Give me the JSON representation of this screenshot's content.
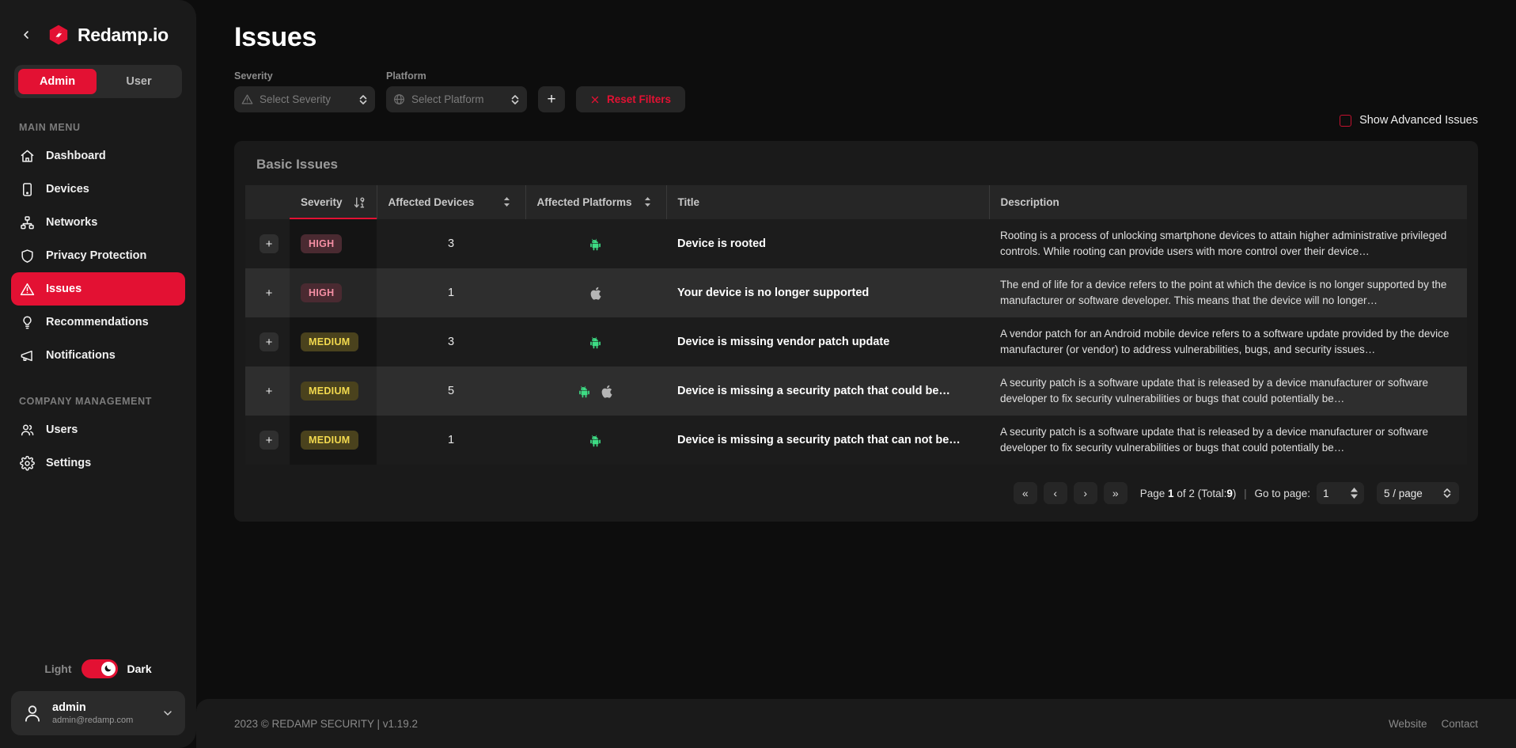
{
  "sidebar": {
    "back_icon": "chevron-left-icon",
    "brand": "Redamp.io",
    "roles": [
      {
        "label": "Admin",
        "active": true
      },
      {
        "label": "User",
        "active": false
      }
    ],
    "main_menu_label": "MAIN MENU",
    "main_menu": [
      {
        "label": "Dashboard",
        "icon": "home-icon",
        "active": false
      },
      {
        "label": "Devices",
        "icon": "device-icon",
        "active": false
      },
      {
        "label": "Networks",
        "icon": "network-icon",
        "active": false
      },
      {
        "label": "Privacy Protection",
        "icon": "shield-icon",
        "active": false
      },
      {
        "label": "Issues",
        "icon": "warning-triangle-icon",
        "active": true
      },
      {
        "label": "Recommendations",
        "icon": "lightbulb-icon",
        "active": false
      },
      {
        "label": "Notifications",
        "icon": "megaphone-icon",
        "active": false
      }
    ],
    "company_label": "COMPANY MANAGEMENT",
    "company_menu": [
      {
        "label": "Users",
        "icon": "users-icon",
        "active": false
      },
      {
        "label": "Settings",
        "icon": "gear-icon",
        "active": false
      }
    ],
    "theme": {
      "light_label": "Light",
      "dark_label": "Dark",
      "active": "Dark"
    },
    "user": {
      "name": "admin",
      "email": "admin@redamp.com"
    }
  },
  "header": {
    "title": "Issues"
  },
  "filters": {
    "severity": {
      "label": "Severity",
      "placeholder": "Select Severity",
      "icon": "warning-triangle-icon"
    },
    "platform": {
      "label": "Platform",
      "placeholder": "Select Platform",
      "icon": "globe-icon"
    },
    "add_label": "+",
    "reset_label": "Reset Filters",
    "advanced_label": "Show Advanced Issues",
    "advanced_checked": false
  },
  "card": {
    "title": "Basic Issues"
  },
  "table": {
    "columns": [
      {
        "key": "expand",
        "label": ""
      },
      {
        "key": "severity",
        "label": "Severity",
        "sortable": true,
        "sorted": true,
        "sort_icon": "sort-descending-icon"
      },
      {
        "key": "devices",
        "label": "Affected Devices",
        "sortable": true,
        "sort_icon": "sort-icon"
      },
      {
        "key": "platforms",
        "label": "Affected Platforms",
        "sortable": true,
        "sort_icon": "sort-icon"
      },
      {
        "key": "title",
        "label": "Title",
        "sortable": false
      },
      {
        "key": "description",
        "label": "Description",
        "sortable": false
      }
    ],
    "rows": [
      {
        "severity": "HIGH",
        "severity_class": "high",
        "devices": "3",
        "platforms": [
          "android"
        ],
        "title": "Device is rooted",
        "description": "Rooting is a process of unlocking smartphone devices to attain higher administrative privileged controls. While rooting can provide users with more control over their device…"
      },
      {
        "severity": "HIGH",
        "severity_class": "high",
        "devices": "1",
        "platforms": [
          "apple"
        ],
        "title": "Your device is no longer supported",
        "description": "The end of life for a device refers to the point at which the device is no longer supported by the manufacturer or software developer. This means that the device will no longer…"
      },
      {
        "severity": "MEDIUM",
        "severity_class": "medium",
        "devices": "3",
        "platforms": [
          "android"
        ],
        "title": "Device is missing vendor patch update",
        "description": "A vendor patch for an Android mobile device refers to a software update provided by the device manufacturer (or vendor) to address vulnerabilities, bugs, and security issues…"
      },
      {
        "severity": "MEDIUM",
        "severity_class": "medium",
        "devices": "5",
        "platforms": [
          "android",
          "apple"
        ],
        "title": "Device is missing a security patch that could be…",
        "description": "A security patch is a software update that is released by a device manufacturer or software developer to fix security vulnerabilities or bugs that could potentially be…"
      },
      {
        "severity": "MEDIUM",
        "severity_class": "medium",
        "devices": "1",
        "platforms": [
          "android"
        ],
        "title": "Device is missing a security patch that can not be…",
        "description": "A security patch is a software update that is released by a device manufacturer or software developer to fix security vulnerabilities or bugs that could potentially be…"
      }
    ]
  },
  "pagination": {
    "first_label": "«",
    "prev_label": "‹",
    "next_label": "›",
    "last_label": "»",
    "page_prefix": "Page",
    "current_page": "1",
    "page_of": "of 2",
    "total_prefix": "(Total:",
    "total": "9",
    "total_suffix": ")",
    "goto_label": "Go to page:",
    "goto_value": "1",
    "page_size": "5 / page"
  },
  "footer": {
    "copyright": "2023 © REDAMP SECURITY | v1.19.2",
    "links": [
      "Website",
      "Contact"
    ]
  },
  "colors": {
    "accent": "#e31133",
    "high_badge_bg": "#4a2a31",
    "high_badge_fg": "#f58fa4",
    "medium_badge_bg": "#4a421d",
    "medium_badge_fg": "#f2d94e",
    "android_green": "#3ddc84",
    "apple_grey": "#b5b5b5"
  }
}
